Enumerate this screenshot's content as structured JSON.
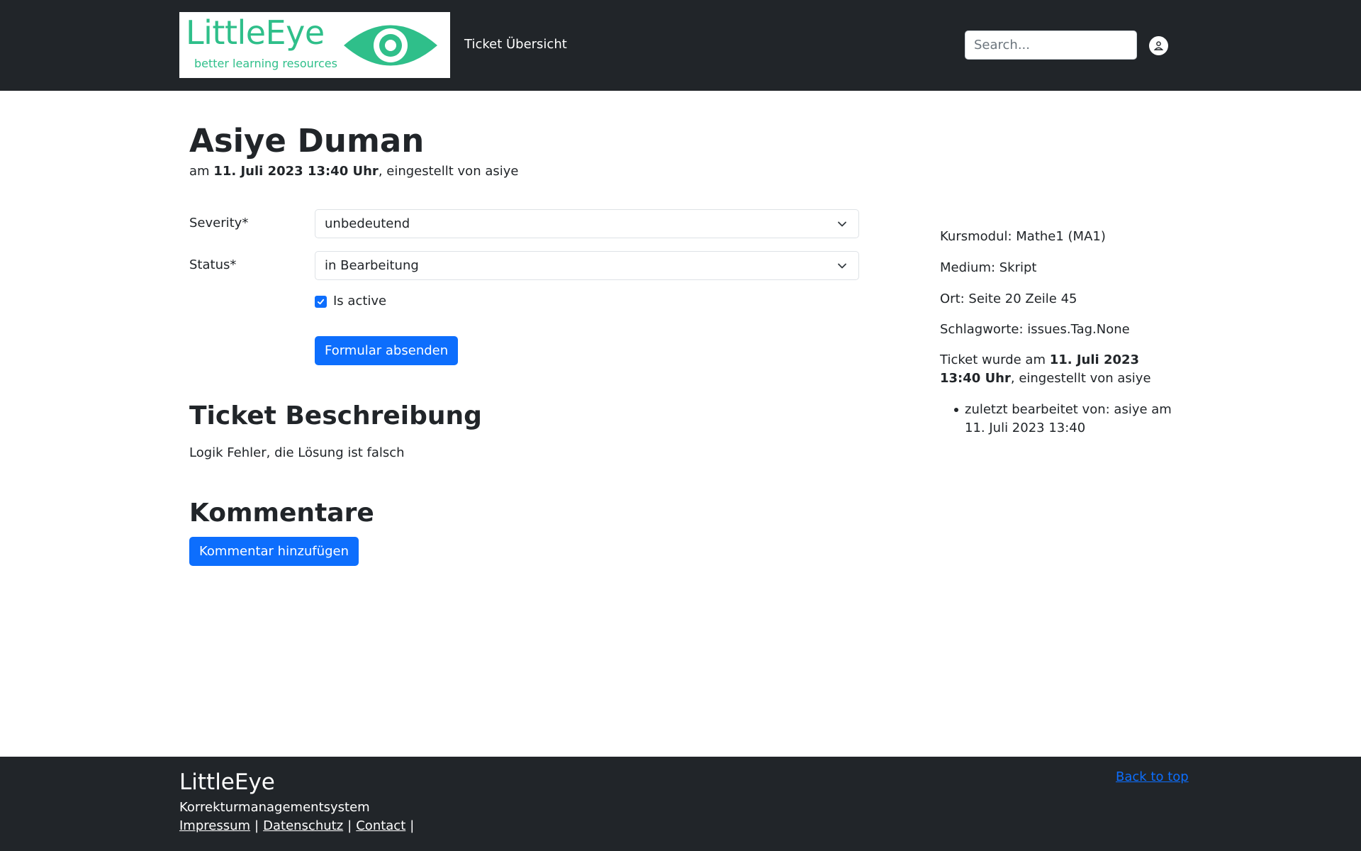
{
  "header": {
    "logo_title": "LittleEye",
    "logo_subtitle": "better learning resources",
    "nav_link": "Ticket Übersicht",
    "search_placeholder": "Search..."
  },
  "ticket": {
    "title": "Asiye Duman",
    "meta_prefix": "am ",
    "meta_date": "11. Juli 2023 13:40 Uhr",
    "meta_suffix": ", eingestellt von asiye"
  },
  "form": {
    "severity_label": "Severity*",
    "severity_value": "unbedeutend",
    "status_label": "Status*",
    "status_value": "in Bearbeitung",
    "is_active_label": "Is active",
    "is_active_checked": true,
    "submit_label": "Formular absenden"
  },
  "description": {
    "heading": "Ticket Beschreibung",
    "text": "Logik Fehler, die Lösung ist falsch"
  },
  "comments": {
    "heading": "Kommentare",
    "add_label": "Kommentar hinzufügen"
  },
  "sidebar": {
    "kursmodul": "Kursmodul: Mathe1 (MA1)",
    "medium": "Medium: Skript",
    "ort": "Ort: Seite 20 Zeile 45",
    "schlagworte": "Schlagworte: issues.Tag.None",
    "created_prefix": "Ticket wurde am ",
    "created_date": "11. Juli 2023 13:40 Uhr",
    "created_suffix": ", eingestellt von asiye",
    "history": [
      "zuletzt bearbeitet von: asiye am 11. Juli 2023 13:40"
    ]
  },
  "footer": {
    "title": "LittleEye",
    "subtitle": "Korrekturmanagementsystem",
    "links": [
      "Impressum",
      "Datenschutz",
      "Contact"
    ],
    "separator": "|",
    "back_to_top": "Back to top"
  },
  "colors": {
    "navbar_bg": "#212529",
    "brand_green": "#2fbf8a",
    "primary": "#0d6efd"
  },
  "icons": {
    "logo": "eye-icon",
    "user": "user-icon",
    "select": "chevron-down-icon",
    "checkbox": "check-icon"
  }
}
